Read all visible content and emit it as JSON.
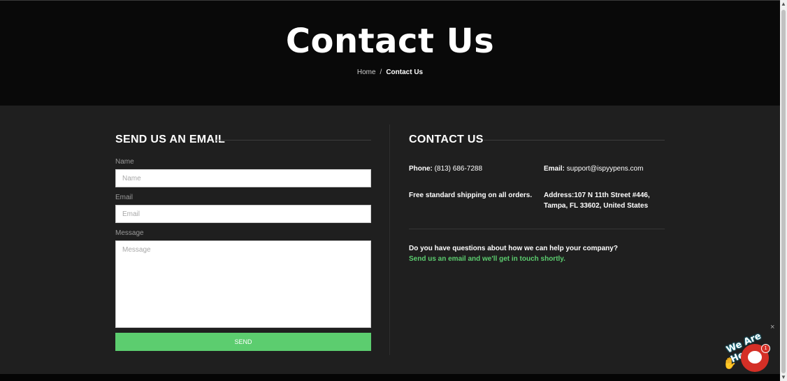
{
  "hero": {
    "title": "Contact Us",
    "breadcrumb": {
      "home": "Home",
      "separator": "/",
      "current": "Contact Us"
    }
  },
  "form": {
    "section_title": "SEND US AN EMAIL",
    "name": {
      "label": "Name",
      "placeholder": "Name",
      "value": ""
    },
    "email": {
      "label": "Email",
      "placeholder": "Email",
      "value": ""
    },
    "message": {
      "label": "Message",
      "placeholder": "Message",
      "value": ""
    },
    "send_label": "SEND"
  },
  "contact": {
    "section_title": "CONTACT US",
    "phone_label": "Phone:",
    "phone_value": "(813) 686-7288",
    "email_label": "Email:",
    "email_value": "support@ispyypens.com",
    "shipping": "Free standard shipping on all orders.",
    "address_label": "Address:",
    "address_value": "107 N 11th Street #446, Tampa, FL 33602, United States",
    "question": "Do you have questions about how we can help your company?",
    "cta": "Send us an email and we'll get in touch shortly."
  },
  "chat_widget": {
    "text": "We Are Here!",
    "badge": "1",
    "close": "×"
  },
  "colors": {
    "accent_green": "#5ccd6f",
    "hero_bg": "#090909",
    "page_bg": "#1f1f1f",
    "chat_red": "#d42f26"
  }
}
